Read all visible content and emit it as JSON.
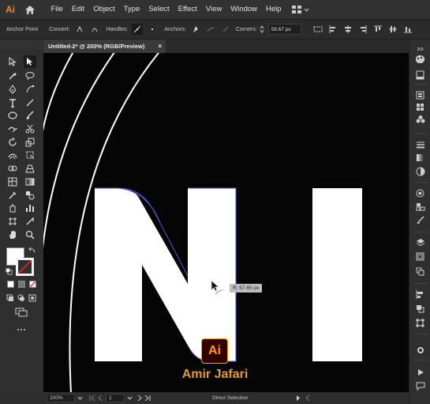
{
  "app": {
    "logo_text": "Ai",
    "menu": [
      "File",
      "Edit",
      "Object",
      "Type",
      "Select",
      "Effect",
      "View",
      "Window",
      "Help"
    ]
  },
  "control_bar": {
    "anchor_point_label": "Anchor Point",
    "convert_label": "Convert:",
    "handles_label": "Handles:",
    "anchors_label": "Anchors:",
    "corners_label": "Corners:",
    "corners_value": "58.67 px"
  },
  "document": {
    "tab_title": "Untitled-2* @ 200% (RGB/Preview)",
    "close_glyph": "×"
  },
  "canvas": {
    "letters": [
      "N",
      "I"
    ],
    "tooltip": "R: 57.65 px"
  },
  "watermark": {
    "logo_text": "Ai",
    "author": "Amir Jafari"
  },
  "status_bar": {
    "zoom": "200%",
    "artboard": "1",
    "current_tool": "Direct Selection"
  },
  "colors": {
    "accent": "#e8892b",
    "selection_path": "#4a5ac8",
    "canvas_bg": "#050505",
    "ui_bg": "#323232"
  }
}
